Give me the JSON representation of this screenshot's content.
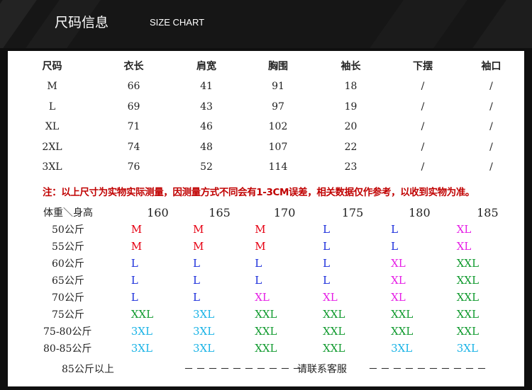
{
  "header": {
    "title_cn": "尺码信息",
    "title_en": "SIZE CHART"
  },
  "measure_table": {
    "columns": [
      "尺码",
      "衣长",
      "肩宽",
      "胸围",
      "袖长",
      "下摆",
      "袖口"
    ],
    "rows": [
      [
        "M",
        "66",
        "41",
        "91",
        "18",
        "/",
        "/"
      ],
      [
        "L",
        "69",
        "43",
        "97",
        "19",
        "/",
        "/"
      ],
      [
        "XL",
        "71",
        "46",
        "102",
        "20",
        "/",
        "/"
      ],
      [
        "2XL",
        "74",
        "48",
        "107",
        "22",
        "/",
        "/"
      ],
      [
        "3XL",
        "76",
        "52",
        "114",
        "23",
        "/",
        "/"
      ]
    ]
  },
  "note": "注：以上尺寸为实物实际测量，因测量方式不同会有1-3CM误差，相关数据仅作参考，以收到实物为准。",
  "recommend_table": {
    "corner_label": "体重＼身高",
    "heights": [
      "160",
      "165",
      "170",
      "175",
      "180",
      "185"
    ],
    "rows": [
      {
        "weight": "50公斤",
        "sizes": [
          "M",
          "M",
          "M",
          "L",
          "L",
          "XL"
        ]
      },
      {
        "weight": "55公斤",
        "sizes": [
          "M",
          "M",
          "M",
          "L",
          "L",
          "XL"
        ]
      },
      {
        "weight": "60公斤",
        "sizes": [
          "L",
          "L",
          "L",
          "L",
          "XL",
          "XXL"
        ]
      },
      {
        "weight": "65公斤",
        "sizes": [
          "L",
          "L",
          "L",
          "L",
          "XL",
          "XXL"
        ]
      },
      {
        "weight": "70公斤",
        "sizes": [
          "L",
          "L",
          "XL",
          "XL",
          "XL",
          "XXL"
        ]
      },
      {
        "weight": "75公斤",
        "sizes": [
          "XXL",
          "3XL",
          "XXL",
          "XXL",
          "XXL",
          "XXL"
        ]
      },
      {
        "weight": "75-80公斤",
        "sizes": [
          "3XL",
          "3XL",
          "XXL",
          "XXL",
          "XXL",
          "XXL"
        ]
      },
      {
        "weight": "80-85公斤",
        "sizes": [
          "3XL",
          "3XL",
          "XXL",
          "XXL",
          "3XL",
          "3XL"
        ]
      }
    ],
    "last_row": {
      "weight": "85公斤以上",
      "dashes": "－－－－－－－－－－",
      "text": "请联系客服"
    },
    "size_colors": {
      "M": "#e60012",
      "L": "#1a2ddb",
      "XL": "#e61ee6",
      "XXL": "#109a2e",
      "3XL": "#19b3e6"
    }
  }
}
